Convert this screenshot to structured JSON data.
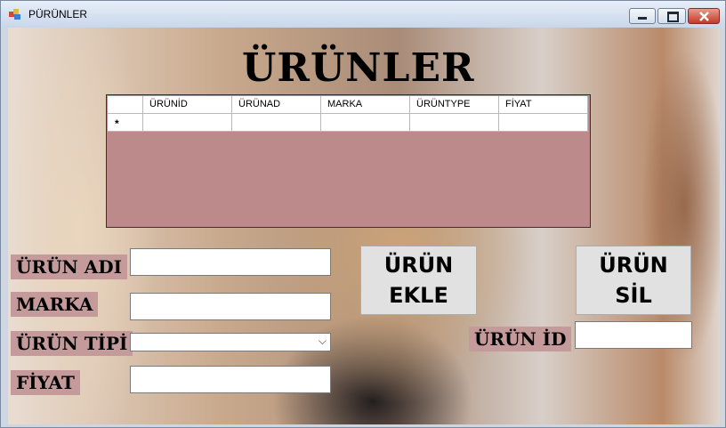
{
  "window": {
    "title": "PÜRÜNLER",
    "controls": {
      "minimize_icon": "minimize-icon",
      "maximize_icon": "maximize-icon",
      "close_icon": "close-icon"
    }
  },
  "heading": "ÜRÜNLER",
  "grid": {
    "columns": [
      "ÜRÜNİD",
      "ÜRÜNAD",
      "MARKA",
      "ÜRÜNTYPE",
      "FİYAT"
    ],
    "new_row_marker": "*",
    "rows": [],
    "empty_area_color": "#bc8a8a"
  },
  "form": {
    "urun_adi_label": "ÜRÜN ADI",
    "marka_label": "MARKA",
    "urun_tipi_label": "ÜRÜN TİPİ",
    "fiyat_label": "FİYAT",
    "urun_id_label": "ÜRÜN İD",
    "urun_adi_value": "",
    "marka_value": "",
    "urun_tipi_value": "",
    "fiyat_value": "",
    "urun_id_value": ""
  },
  "buttons": {
    "add_line1": "ÜRÜN",
    "add_line2": "EKLE",
    "delete_line1": "ÜRÜN",
    "delete_line2": "SİL"
  },
  "colors": {
    "label_bg": "#c49a9a",
    "button_bg": "#e1e1e1"
  }
}
